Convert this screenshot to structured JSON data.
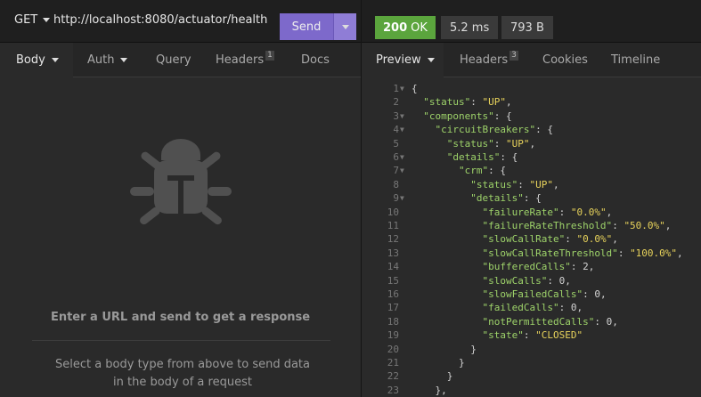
{
  "request": {
    "method": "GET",
    "url": "http://localhost:8080/actuator/health",
    "send_label": "Send"
  },
  "response_meta": {
    "status_code": "200",
    "status_text": "OK",
    "time": "5.2 ms",
    "size": "793 B",
    "status_color": "#5ba53d"
  },
  "request_tabs": [
    {
      "label": "Body",
      "dropdown": true,
      "active": true
    },
    {
      "label": "Auth",
      "dropdown": true,
      "active": false
    },
    {
      "label": "Query",
      "active": false
    },
    {
      "label": "Headers",
      "badge": "1",
      "active": false
    },
    {
      "label": "Docs",
      "active": false
    }
  ],
  "response_tabs": [
    {
      "label": "Preview",
      "dropdown": true,
      "active": true
    },
    {
      "label": "Headers",
      "badge": "3",
      "active": false
    },
    {
      "label": "Cookies",
      "active": false
    },
    {
      "label": "Timeline",
      "active": false
    }
  ],
  "empty_state": {
    "icon": "bug-icon",
    "title": "Enter a URL and send to get a response",
    "subtitle": "Select a body type from above to send data in the body of a request"
  },
  "code_lines": [
    {
      "n": "1",
      "fold": true,
      "text": "{"
    },
    {
      "n": "2",
      "fold": false,
      "text": "  \"status\": \"UP\","
    },
    {
      "n": "3",
      "fold": true,
      "text": "  \"components\": {"
    },
    {
      "n": "4",
      "fold": true,
      "text": "    \"circuitBreakers\": {"
    },
    {
      "n": "5",
      "fold": false,
      "text": "      \"status\": \"UP\","
    },
    {
      "n": "6",
      "fold": true,
      "text": "      \"details\": {"
    },
    {
      "n": "7",
      "fold": true,
      "text": "        \"crm\": {"
    },
    {
      "n": "8",
      "fold": false,
      "text": "          \"status\": \"UP\","
    },
    {
      "n": "9",
      "fold": true,
      "text": "          \"details\": {"
    },
    {
      "n": "10",
      "fold": false,
      "text": "            \"failureRate\": \"0.0%\","
    },
    {
      "n": "11",
      "fold": false,
      "text": "            \"failureRateThreshold\": \"50.0%\","
    },
    {
      "n": "12",
      "fold": false,
      "text": "            \"slowCallRate\": \"0.0%\","
    },
    {
      "n": "13",
      "fold": false,
      "text": "            \"slowCallRateThreshold\": \"100.0%\","
    },
    {
      "n": "14",
      "fold": false,
      "text": "            \"bufferedCalls\": 2,"
    },
    {
      "n": "15",
      "fold": false,
      "text": "            \"slowCalls\": 0,"
    },
    {
      "n": "16",
      "fold": false,
      "text": "            \"slowFailedCalls\": 0,"
    },
    {
      "n": "17",
      "fold": false,
      "text": "            \"failedCalls\": 0,"
    },
    {
      "n": "18",
      "fold": false,
      "text": "            \"notPermittedCalls\": 0,"
    },
    {
      "n": "19",
      "fold": false,
      "text": "            \"state\": \"CLOSED\""
    },
    {
      "n": "20",
      "fold": false,
      "text": "          }"
    },
    {
      "n": "21",
      "fold": false,
      "text": "        }"
    },
    {
      "n": "22",
      "fold": false,
      "text": "      }"
    },
    {
      "n": "23",
      "fold": false,
      "text": "    },"
    }
  ]
}
